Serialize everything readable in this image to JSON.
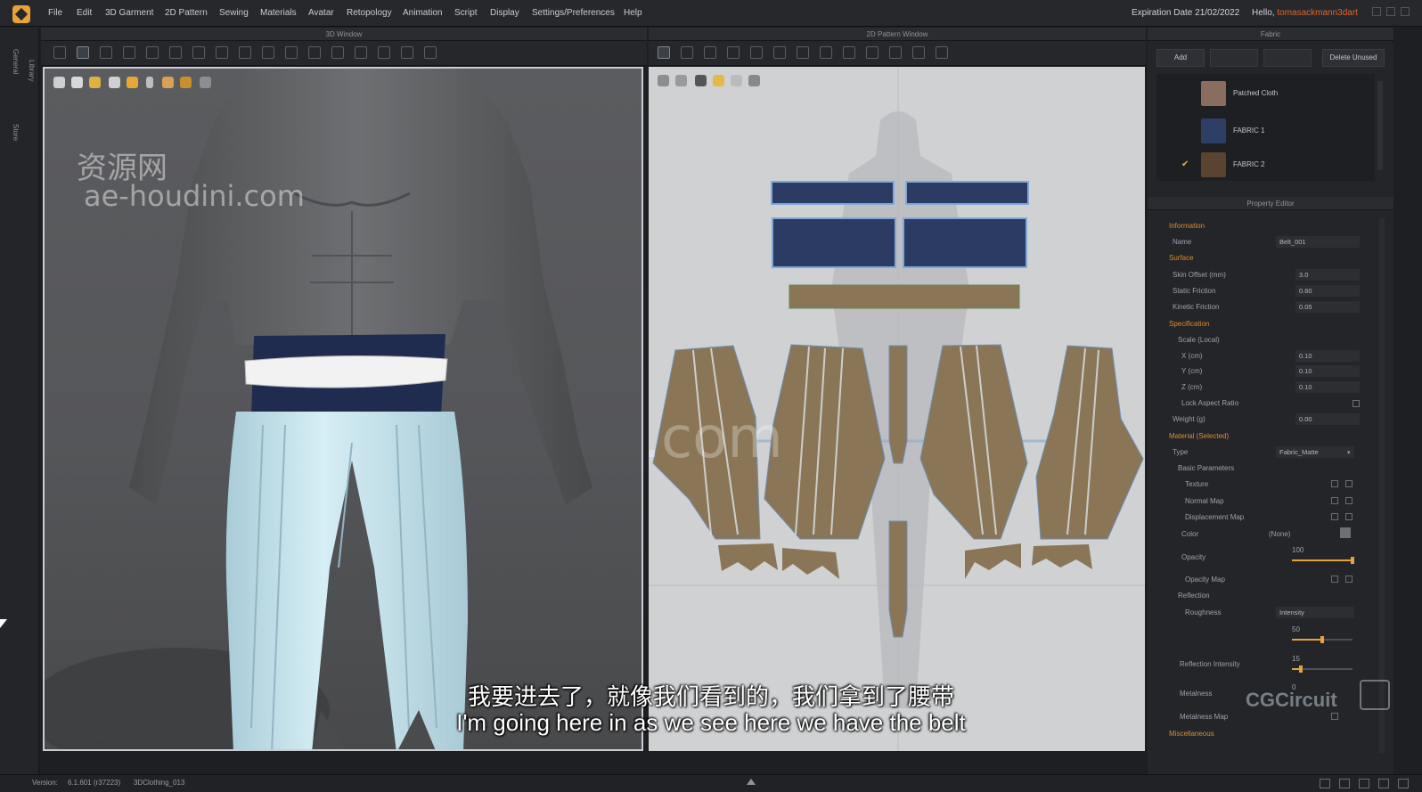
{
  "menubar": {
    "items": [
      "File",
      "Edit",
      "3D Garment",
      "2D Pattern",
      "Sewing",
      "Materials",
      "Avatar",
      "Retopology",
      "Animation",
      "Script",
      "Display",
      "Settings/Preferences",
      "Help"
    ],
    "expiration": "Expiration Date 21/02/2022",
    "hello_prefix": "Hello,",
    "username": "tomasackmann3dart"
  },
  "left_strip": {
    "tabs": [
      "General",
      "Library",
      "Store"
    ]
  },
  "panels": {
    "window3d_title": "3D Window",
    "window2d_title": "2D Pattern Window",
    "fabric_title": "Fabric",
    "property_title": "Property Editor"
  },
  "fabric": {
    "add_label": "Add",
    "delete_unused_label": "Delete Unused",
    "items": [
      {
        "name": "Patched Cloth",
        "color": "#8a6d5e",
        "checked": false
      },
      {
        "name": "FABRIC 1",
        "color": "#2e3f66",
        "checked": false
      },
      {
        "name": "FABRIC 2",
        "color": "#5a4330",
        "checked": true
      }
    ],
    "check_glyph": "✔"
  },
  "property": {
    "information": "Information",
    "name_label": "Name",
    "name_value": "Belt_001",
    "surface": "Surface",
    "skin_offset_label": "Skin Offset (mm)",
    "skin_offset_value": "3.0",
    "static_friction_label": "Static Friction",
    "static_friction_value": "0.60",
    "kinetic_friction_label": "Kinetic Friction",
    "kinetic_friction_value": "0.05",
    "specification": "Specification",
    "scale_local": "Scale (Local)",
    "x_label": "X (cm)",
    "x_value": "0.10",
    "y_label": "Y (cm)",
    "y_value": "0.10",
    "z_label": "Z (cm)",
    "z_value": "0.10",
    "lock_aspect_label": "Lock Aspect Ratio",
    "weight_label": "Weight (g)",
    "weight_value": "0.00",
    "material_selected": "Material (Selected)",
    "type_label": "Type",
    "type_value": "Fabric_Matte",
    "basic_parameters": "Basic Parameters",
    "texture_label": "Texture",
    "normal_map_label": "Normal Map",
    "displacement_map_label": "Displacement Map",
    "color_label": "Color",
    "color_value": "(None)",
    "opacity_label": "Opacity",
    "opacity_value": "100",
    "opacity_level": 1.0,
    "opacity_map_label": "Opacity Map",
    "reflection": "Reflection",
    "roughness_label": "Roughness",
    "roughness_type": "Intensity",
    "roughness_value": "50",
    "roughness_level": 0.5,
    "reflection_intensity_label": "Reflection Intensity",
    "reflection_intensity_value": "15",
    "reflection_intensity_level": 0.15,
    "metalness_label": "Metalness",
    "metalness_value": "0",
    "metalness_map_label": "Metalness Map",
    "miscellaneous": "Miscellaneous"
  },
  "status": {
    "version_label": "Version:",
    "version_value": "6.1.601 (r37223)",
    "file_name": "3DClothing_013"
  },
  "subtitle": {
    "chinese": "我要进去了，就像我们看到的，我们拿到了腰带",
    "english": "I'm going here in as we see here we have the belt"
  },
  "watermarks": {
    "cn": "资源网",
    "site": "ae-houdini.com",
    "center": "iiivfx.com",
    "brand": "CGCircuit"
  },
  "colors": {
    "accent": "#e8a23a",
    "section": "#e08a2a",
    "pants": "#c8e6f0",
    "belt_navy": "#1f2c4f",
    "pattern_fabric": "#8a7656",
    "pattern_navy": "#2c3b63"
  }
}
